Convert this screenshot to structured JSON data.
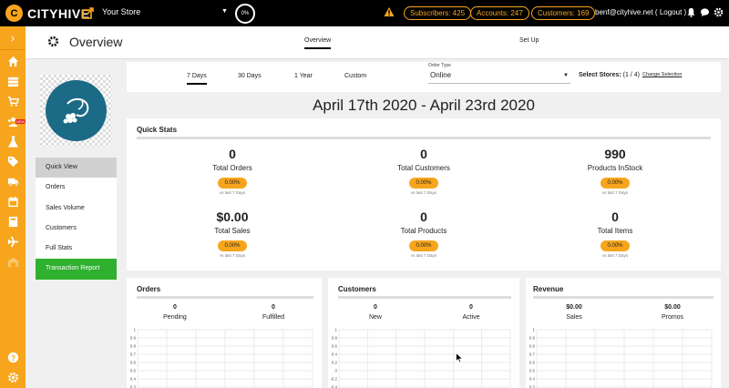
{
  "brand": {
    "logo_letter": "C",
    "name": "CITYHIVE"
  },
  "topbar": {
    "store_name": "Your Store",
    "progress_percent_label": "0%",
    "subscribers": "Subscribers: 425",
    "accounts": "Accounts: 247",
    "customers": "Customers: 169",
    "user": "benf@cityhive.net ( Logout )"
  },
  "leftnav": {
    "expand_symbol": "›",
    "icons": [
      "home-icon",
      "grid-icon",
      "cart-icon",
      "users-icon",
      "flask-icon",
      "tags-icon",
      "truck-icon",
      "calendar-icon",
      "book-icon",
      "plane-icon",
      "warehouse-icon",
      "help-icon",
      "settings-icon"
    ],
    "cart_badge": "NEW"
  },
  "header": {
    "title": "Overview",
    "tabs": [
      {
        "label": "Overview",
        "active": true
      },
      {
        "label": "Set Up",
        "active": false
      }
    ]
  },
  "side_menu": [
    {
      "label": "Quick View",
      "active": true
    },
    {
      "label": "Orders"
    },
    {
      "label": "Sales Volume"
    },
    {
      "label": "Customers"
    },
    {
      "label": "Full Stats"
    },
    {
      "label": "Transaction Report",
      "highlight": true
    }
  ],
  "filters": {
    "ranges": [
      "7 Days",
      "30 Days",
      "1 Year",
      "Custom"
    ],
    "active_range": "7 Days",
    "order_type_label": "Order Type",
    "order_type_value": "Online",
    "select_stores_label": "Select Stores:",
    "select_stores_count": "(1 / 4)",
    "change_selection": "Change Selection"
  },
  "date_range": "April 17th 2020 - April 23rd 2020",
  "quick_stats": {
    "title": "Quick Stats",
    "items": [
      {
        "value": "0",
        "label": "Total Orders",
        "pct": "0.00%",
        "sub": "vs last 7 Days"
      },
      {
        "value": "0",
        "label": "Total Customers",
        "pct": "0.00%",
        "sub": "vs last 7 Days"
      },
      {
        "value": "990",
        "label": "Products InStock",
        "pct": "0.00%",
        "sub": "vs last 7 Days"
      },
      {
        "value": "$0.00",
        "label": "Total Sales",
        "pct": "0.00%",
        "sub": "vs last 7 Days"
      },
      {
        "value": "0",
        "label": "Total Products",
        "pct": "0.00%",
        "sub": "vs last 7 Days"
      },
      {
        "value": "0",
        "label": "Total Items",
        "pct": "0.00%",
        "sub": "vs last 7 Days"
      }
    ]
  },
  "orders_card": {
    "title": "Orders",
    "stats": [
      {
        "value": "0",
        "label": "Pending"
      },
      {
        "value": "0",
        "label": "Fulfilled"
      }
    ],
    "y_ticks": [
      "1",
      "0.9",
      "0.8",
      "0.7",
      "0.6",
      "0.5",
      "0.4",
      "0.3",
      "0.2",
      "0.1"
    ]
  },
  "customers_card": {
    "title": "Customers",
    "stats": [
      {
        "value": "0",
        "label": "New"
      },
      {
        "value": "0",
        "label": "Active"
      }
    ],
    "y_ticks": [
      "1",
      "0.8",
      "0.6",
      "0.4",
      "0.2",
      "0",
      "-0.2",
      "-0.4"
    ]
  },
  "revenue_card": {
    "title": "Revenue",
    "stats": [
      {
        "value": "$0.00",
        "label": "Sales"
      },
      {
        "value": "$0.00",
        "label": "Promos"
      }
    ],
    "y_ticks": [
      "1",
      "0.9",
      "0.8",
      "0.7",
      "0.6",
      "0.5",
      "0.4",
      "0.3",
      "0.2",
      "0.1"
    ]
  },
  "colors": {
    "accent": "#f7a51c",
    "green": "#2fb02f",
    "teal": "#1b6a86",
    "topbar": "#000000"
  }
}
